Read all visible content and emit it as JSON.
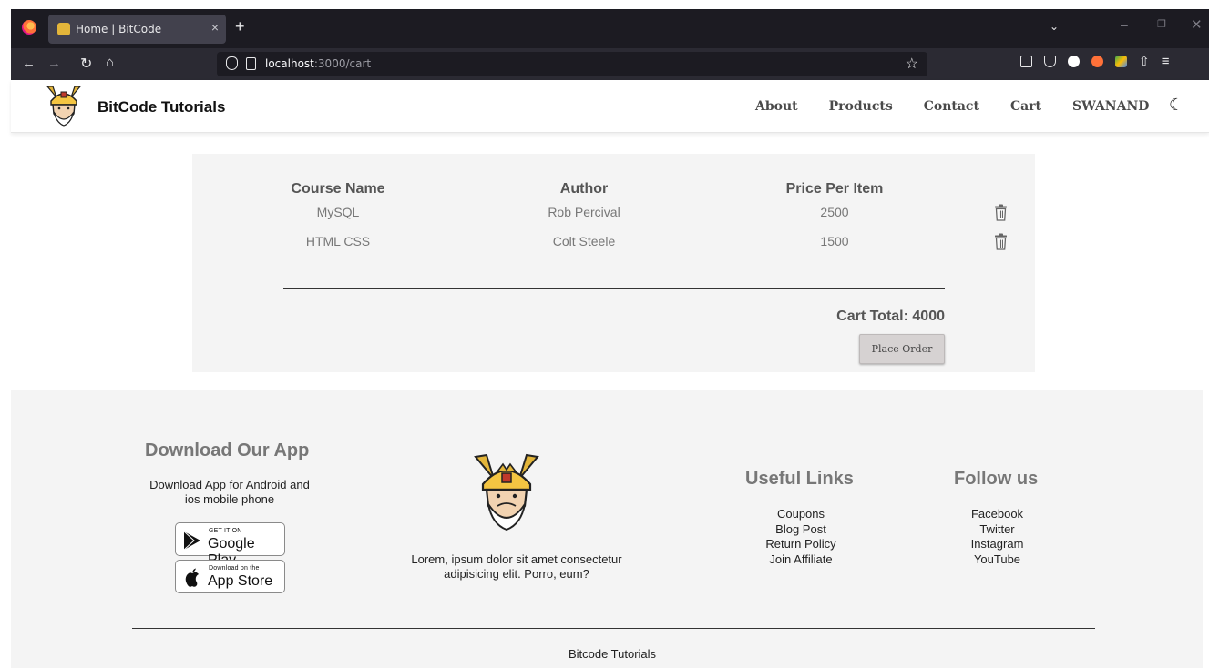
{
  "browser": {
    "tab_title": "Home | BitCode",
    "tab_close": "×",
    "new_tab": "+",
    "url_host": "localhost",
    "url_path": ":3000/cart",
    "icons": [
      "firefox-icon",
      "back-arrow-icon",
      "forward-arrow-icon",
      "reload-icon",
      "home-icon",
      "shield-icon",
      "page-icon",
      "star-icon",
      "folder-icon",
      "pocket-icon",
      "extension-icon",
      "share-icon",
      "menu-icon"
    ]
  },
  "site": {
    "brand": "BitCode Tutorials",
    "nav": {
      "about": "About",
      "products": "Products",
      "contact": "Contact",
      "cart": "Cart",
      "user": "SWANAND"
    },
    "theme_icon": "moon-icon"
  },
  "cart": {
    "headers": {
      "course": "Course Name",
      "author": "Author",
      "price": "Price Per Item"
    },
    "rows": [
      {
        "course": "MySQL",
        "author": "Rob Percival",
        "price": "2500"
      },
      {
        "course": "HTML CSS",
        "author": "Colt Steele",
        "price": "1500"
      }
    ],
    "total_label": "Cart Total: 4000",
    "place_order": "Place Order"
  },
  "footer": {
    "app_title": "Download Our App",
    "app_text": "Download App for Android and ios mobile phone",
    "google_small": "GET IT ON",
    "google_big": "Google Play",
    "apple_small": "Download on the",
    "apple_big": "App Store",
    "lorem": "Lorem, ipsum dolor sit amet consectetur adipisicing elit. Porro, eum?",
    "useful_title": "Useful Links",
    "useful_links": [
      "Coupons",
      "Blog Post",
      "Return Policy",
      "Join Affiliate"
    ],
    "follow_title": "Follow us",
    "follow_links": [
      "Facebook",
      "Twitter",
      "Instagram",
      "YouTube"
    ],
    "copyright": "Bitcode Tutorials"
  },
  "colors": {
    "tab_bar": "#1c1b22",
    "nav_bar": "#2b2a33",
    "panel_bg": "#f4f4f4",
    "button_bg": "#d6d2d2",
    "logo_gold": "#e3b53a"
  }
}
